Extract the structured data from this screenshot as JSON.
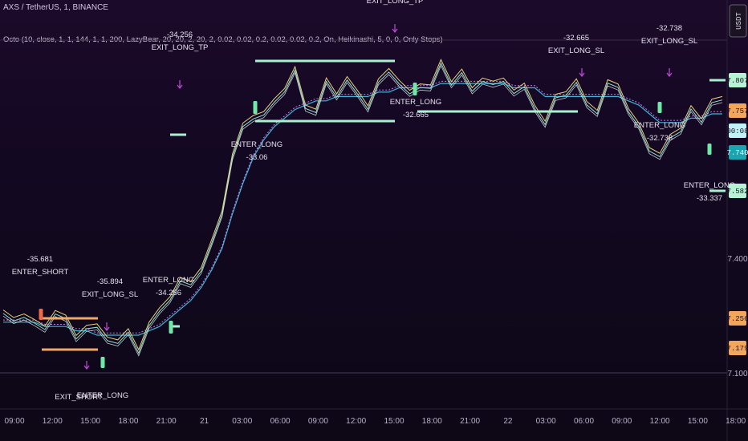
{
  "header": {
    "title": "AXS / TetherUS, 1, BINANCE",
    "indicator": "Octo (10, close, 1, 1, 144, 1, 1, 200, LazyBear, 20, 20, 2, 20, 2, 0.02, 0.02, 0.2, 0.02, 0.02, 0.2, On, Heikinashi, 5, 0, 0, Only Stops)"
  },
  "currency_button": "USDT",
  "colors": {
    "price": "#e9d17a",
    "price2": "#8fe6d6",
    "ma": "#c678f0",
    "ma2": "#3fb4d8",
    "long_line": "#a8f0cf",
    "short_line": "#f0a868",
    "exit_marker": "#c04ad8",
    "badge_green": "#b6f2d4",
    "badge_orange": "#f4a55c",
    "badge_teal": "#1aa5b0",
    "badge_cyan": "#bff3f8"
  },
  "chart_data": {
    "type": "line",
    "title": "AXS / TetherUS, 1, BINANCE",
    "y_ticks": [
      "7.100",
      "7.400"
    ],
    "x_ticks": [
      "09:00",
      "12:00",
      "15:00",
      "18:00",
      "21:00",
      "21",
      "03:00",
      "06:00",
      "09:00",
      "12:00",
      "15:00",
      "18:00",
      "21:00",
      "22",
      "03:00",
      "06:00",
      "09:00",
      "12:00",
      "15:00",
      "18:00"
    ],
    "ylim": [
      7.05,
      7.9
    ],
    "price_badges": [
      {
        "value": "7.807",
        "kind": "green"
      },
      {
        "value": "7.757",
        "kind": "orange"
      },
      {
        "value": "00:08",
        "kind": "cyan"
      },
      {
        "value": "7.740",
        "kind": "teal"
      },
      {
        "value": "7.582",
        "kind": "green"
      },
      {
        "value": "7.256",
        "kind": "orange"
      },
      {
        "value": "7.179",
        "kind": "orange"
      }
    ],
    "annotations": [
      {
        "label": "-35.681",
        "label2": "ENTER_SHORT"
      },
      {
        "label": "-35.894",
        "label2": "EXIT_LONG_SL"
      },
      {
        "label": "ENTER_LONG",
        "label2": "-34.256"
      },
      {
        "label": "-34.256",
        "label2": "EXIT_LONG_TP"
      },
      {
        "label": "ENTER_LONG",
        "label2": "-33.06"
      },
      {
        "label": "EXIT_LONG_TP",
        "label2": ""
      },
      {
        "label": "ENTER_LONG",
        "label2": "-32.665"
      },
      {
        "label": "-32.665",
        "label2": "EXIT_LONG_SL"
      },
      {
        "label": "-32.738",
        "label2": "EXIT_LONG_SL"
      },
      {
        "label": "ENTER_LONG",
        "label2": "-32.738"
      },
      {
        "label": "ENTER_LONG",
        "label2": "-33.337"
      },
      {
        "label": "EXIT_SHORT",
        "label2": ""
      },
      {
        "label": "ENTER_LONG",
        "label2": ""
      }
    ],
    "series": [
      {
        "values": [
          7.26,
          7.24,
          7.28,
          7.25,
          7.23,
          7.27,
          7.24,
          7.22,
          7.25,
          7.23,
          7.21,
          7.19,
          7.22,
          7.2,
          7.24,
          7.27,
          7.3,
          7.33,
          7.35,
          7.38,
          7.42,
          7.5,
          7.62,
          7.7,
          7.74,
          7.72,
          7.75,
          7.78,
          7.82,
          7.76,
          7.74,
          7.79,
          7.77,
          7.8,
          7.78,
          7.76,
          7.79,
          7.82,
          7.8,
          7.77,
          7.81,
          7.79,
          7.83,
          7.8,
          7.82,
          7.79,
          7.82,
          7.78,
          7.8,
          7.78,
          7.79,
          7.76,
          7.7,
          7.75,
          7.78,
          7.8,
          7.76,
          7.74,
          7.78,
          7.79,
          7.74,
          7.7,
          7.66,
          7.62,
          7.66,
          7.7,
          7.74,
          7.72,
          7.76,
          7.74
        ]
      },
      {
        "values": [
          7.25,
          7.25,
          7.25,
          7.25,
          7.24,
          7.24,
          7.24,
          7.23,
          7.23,
          7.22,
          7.22,
          7.22,
          7.22,
          7.22,
          7.23,
          7.24,
          7.26,
          7.28,
          7.3,
          7.33,
          7.37,
          7.42,
          7.5,
          7.57,
          7.63,
          7.67,
          7.7,
          7.72,
          7.74,
          7.75,
          7.76,
          7.76,
          7.77,
          7.77,
          7.77,
          7.77,
          7.78,
          7.78,
          7.79,
          7.79,
          7.79,
          7.79,
          7.8,
          7.8,
          7.8,
          7.8,
          7.8,
          7.8,
          7.8,
          7.79,
          7.79,
          7.79,
          7.77,
          7.77,
          7.77,
          7.77,
          7.77,
          7.77,
          7.77,
          7.77,
          7.76,
          7.75,
          7.73,
          7.71,
          7.71,
          7.71,
          7.72,
          7.72,
          7.73,
          7.73
        ]
      }
    ]
  }
}
